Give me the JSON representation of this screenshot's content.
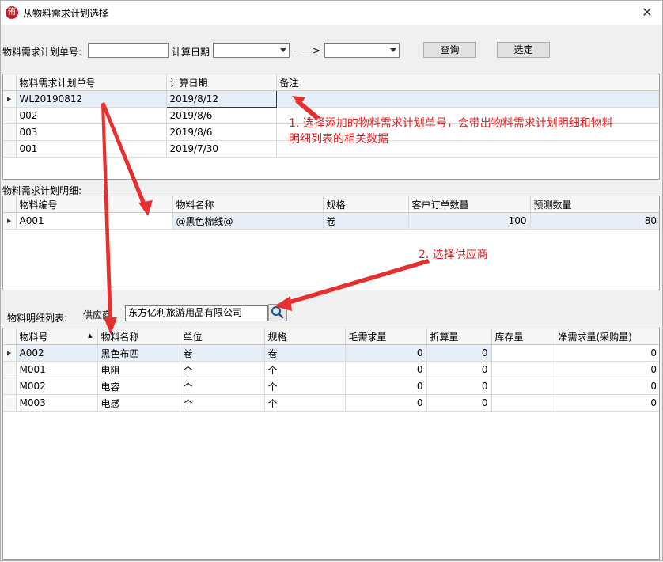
{
  "window": {
    "title": "从物料需求计划选择",
    "close_glyph": "✕",
    "app_glyph": "侑"
  },
  "filter": {
    "plan_no_label": "物料需求计划单号:",
    "plan_no_value": "",
    "calc_date_label": "计算日期",
    "date_from": "",
    "range_arrow": "——>",
    "date_to": "",
    "query_button": "查询",
    "select_button": "选定"
  },
  "plan_grid": {
    "columns": [
      "物料需求计划单号",
      "计算日期",
      "备注"
    ],
    "rows": [
      {
        "no": "WL20190812",
        "date": "2019/8/12",
        "remark": "",
        "selected": true
      },
      {
        "no": "002",
        "date": "2019/8/6",
        "remark": ""
      },
      {
        "no": "003",
        "date": "2019/8/6",
        "remark": ""
      },
      {
        "no": "001",
        "date": "2019/7/30",
        "remark": ""
      }
    ]
  },
  "detail_section": {
    "label": "物料需求计划明细:"
  },
  "detail_grid": {
    "columns": [
      "物料编号",
      "物料名称",
      "规格",
      "客户订单数量",
      "预测数量"
    ],
    "rows": [
      {
        "code": "A001",
        "name": "@黑色棉线@",
        "spec": "卷",
        "order_qty": "100",
        "forecast_qty": "80"
      }
    ]
  },
  "material_section": {
    "label": "物料明细列表:",
    "supplier_label": "供应商",
    "supplier_value": "东方亿利旅游用品有限公司"
  },
  "material_grid": {
    "columns": [
      "物料号",
      "物料名称",
      "单位",
      "规格",
      "毛需求量",
      "折算量",
      "库存量",
      "净需求量(采购量)"
    ],
    "sort_glyph": "▲",
    "rows": [
      {
        "no": "A002",
        "name": "黑色布匹",
        "unit": "卷",
        "spec": "卷",
        "gross": "0",
        "conv": "0",
        "stock": "",
        "net": "0"
      },
      {
        "no": "M001",
        "name": "电阻",
        "unit": "个",
        "spec": "个",
        "gross": "0",
        "conv": "0",
        "stock": "",
        "net": "0"
      },
      {
        "no": "M002",
        "name": "电容",
        "unit": "个",
        "spec": "个",
        "gross": "0",
        "conv": "0",
        "stock": "",
        "net": "0"
      },
      {
        "no": "M003",
        "name": "电感",
        "unit": "个",
        "spec": "个",
        "gross": "0",
        "conv": "0",
        "stock": "",
        "net": "0"
      }
    ]
  },
  "annotations": {
    "note1_line1": "1. 选择添加的物料需求计划单号，会带出物料需求计划明细和物料",
    "note1_line2": "明细列表的相关数据",
    "note2": "2. 选择供应商"
  },
  "colors": {
    "annotation": "#e02020",
    "selected_row": "#e8eef8"
  },
  "icons": {
    "search": "search-icon",
    "row_pointer": "▶"
  }
}
